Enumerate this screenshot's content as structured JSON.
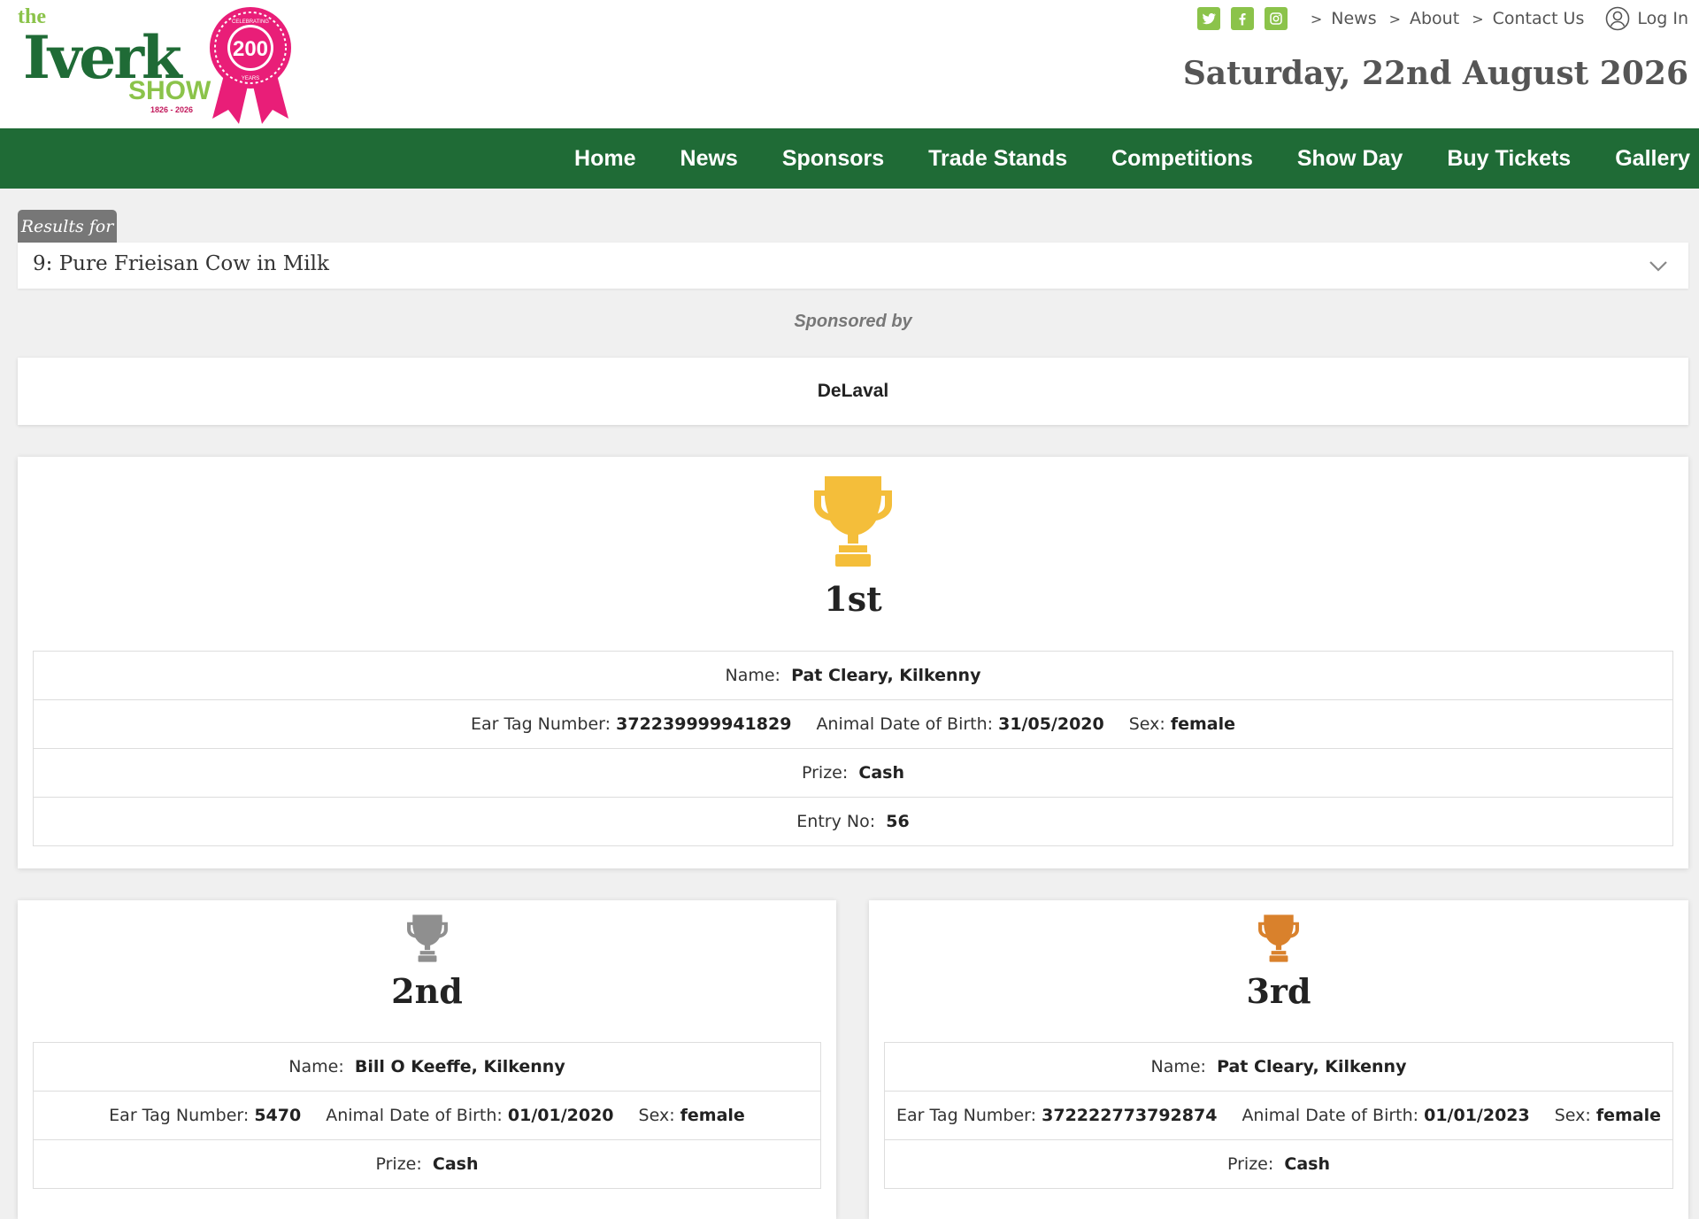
{
  "logo": {
    "the": "the",
    "name": "Iverk",
    "show": "SHOW",
    "years": "1826 - 2026",
    "rosette_number": "200",
    "rosette_text_top": "CELEBRATING",
    "rosette_text_bottom": "YEARS"
  },
  "topbar": {
    "social": [
      "twitter-icon",
      "facebook-icon",
      "instagram-icon"
    ],
    "links": [
      "News",
      "About",
      "Contact Us"
    ],
    "login": "Log In"
  },
  "date": "Saturday, 22nd August 2026",
  "nav": {
    "items": [
      "Home",
      "News",
      "Sponsors",
      "Trade Stands",
      "Competitions",
      "Show Day",
      "Buy Tickets",
      "Gallery"
    ]
  },
  "results": {
    "tab_label": "Results for",
    "selected": "9: Pure Frieisan Cow in Milk"
  },
  "sponsor": {
    "label": "Sponsored by",
    "name": "DeLaval"
  },
  "labels": {
    "name": "Name:",
    "ear_tag": "Ear Tag Number:",
    "dob": "Animal Date of Birth:",
    "sex": "Sex:",
    "prize": "Prize:",
    "entry": "Entry No:"
  },
  "places": [
    {
      "place": "1st",
      "name": "Pat Cleary, Kilkenny",
      "ear_tag": "372239999941829",
      "dob": "31/05/2020",
      "sex": "female",
      "prize": "Cash",
      "entry": "56"
    },
    {
      "place": "2nd",
      "name": "Bill O Keeffe, Kilkenny",
      "ear_tag": "5470",
      "dob": "01/01/2020",
      "sex": "female",
      "prize": "Cash"
    },
    {
      "place": "3rd",
      "name": "Pat Cleary, Kilkenny",
      "ear_tag": "372222773792874",
      "dob": "01/01/2023",
      "sex": "female",
      "prize": "Cash"
    }
  ],
  "colors": {
    "green": "#1f6b36",
    "light_green": "#8bc34a",
    "gold": "#f4be3a",
    "silver": "#8f8f8f",
    "bronze": "#d9812c",
    "rosette_pink": "#e91e78"
  }
}
